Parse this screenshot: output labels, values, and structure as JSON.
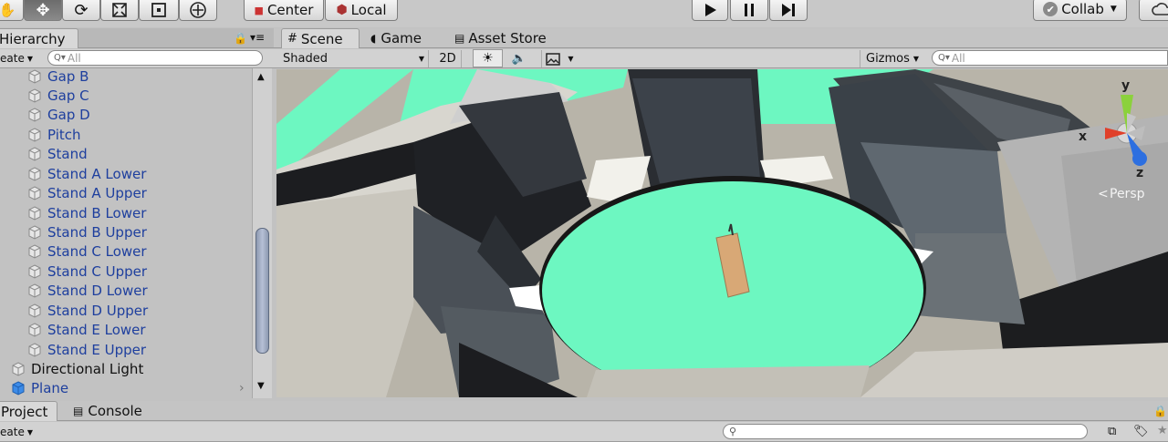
{
  "toolbar": {
    "center_label": "Center",
    "local_label": "Local",
    "collab_label": "Collab"
  },
  "hierarchy": {
    "tab_label": "Hierarchy",
    "create_label": "eate",
    "search_placeholder": "All",
    "items": [
      {
        "label": "Gap B"
      },
      {
        "label": "Gap C"
      },
      {
        "label": "Gap D"
      },
      {
        "label": "Pitch"
      },
      {
        "label": "Stand"
      },
      {
        "label": "Stand A Lower"
      },
      {
        "label": "Stand A Upper"
      },
      {
        "label": "Stand B Lower"
      },
      {
        "label": "Stand B Upper"
      },
      {
        "label": "Stand C Lower"
      },
      {
        "label": "Stand C Upper"
      },
      {
        "label": "Stand D Lower"
      },
      {
        "label": "Stand D Upper"
      },
      {
        "label": "Stand E Lower"
      },
      {
        "label": "Stand E Upper"
      },
      {
        "label": "Directional Light"
      },
      {
        "label": "Plane"
      }
    ]
  },
  "scene": {
    "tabs": [
      {
        "label": "Scene"
      },
      {
        "label": "Game"
      },
      {
        "label": "Asset Store"
      }
    ],
    "shading_mode": "Shaded",
    "toggle_2d": "2D",
    "gizmos_label": "Gizmos",
    "search_placeholder": "All",
    "gizmo": {
      "x": "x",
      "y": "y",
      "z": "z",
      "projection": "Persp"
    }
  },
  "bottom": {
    "tabs": [
      {
        "label": "Project"
      },
      {
        "label": "Console"
      }
    ],
    "create_label": "eate"
  },
  "colors": {
    "accent_green": "#6df7c1",
    "hierarchy_text": "#1e3f9e",
    "selection_blue": "#3d8ce8"
  }
}
